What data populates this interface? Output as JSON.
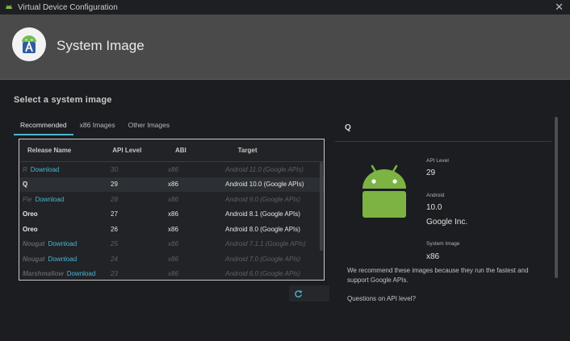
{
  "window": {
    "title": "Virtual Device Configuration",
    "close_glyph": "✕"
  },
  "header": {
    "title": "System Image"
  },
  "section": {
    "title": "Select a system image"
  },
  "tabs": [
    {
      "label": "Recommended",
      "active": true
    },
    {
      "label": "x86 Images",
      "active": false
    },
    {
      "label": "Other Images",
      "active": false
    }
  ],
  "table": {
    "columns": [
      "Release Name",
      "API Level",
      "ABI",
      "Target"
    ],
    "rows": [
      {
        "release": "R",
        "download": "Download",
        "api": "30",
        "abi": "x86",
        "target": "Android 11.0 (Google APIs)",
        "available": false,
        "selected": false
      },
      {
        "release": "Q",
        "download": "",
        "api": "29",
        "abi": "x86",
        "target": "Android 10.0 (Google APIs)",
        "available": true,
        "selected": true
      },
      {
        "release": "Pie",
        "download": "Download",
        "api": "28",
        "abi": "x86",
        "target": "Android 9.0 (Google APIs)",
        "available": false,
        "selected": false
      },
      {
        "release": "Oreo",
        "download": "",
        "api": "27",
        "abi": "x86",
        "target": "Android 8.1 (Google APIs)",
        "available": true,
        "selected": false
      },
      {
        "release": "Oreo",
        "download": "",
        "api": "26",
        "abi": "x86",
        "target": "Android 8.0 (Google APIs)",
        "available": true,
        "selected": false
      },
      {
        "release": "Nougat",
        "download": "Download",
        "api": "25",
        "abi": "x86",
        "target": "Android 7.1.1 (Google APIs)",
        "available": false,
        "selected": false
      },
      {
        "release": "Nougat",
        "download": "Download",
        "api": "24",
        "abi": "x86",
        "target": "Android 7.0 (Google APIs)",
        "available": false,
        "selected": false
      },
      {
        "release": "Marshmallow",
        "download": "Download",
        "api": "23",
        "abi": "x86",
        "target": "Android 6.0 (Google APIs)",
        "available": false,
        "selected": false
      }
    ]
  },
  "details": {
    "title": "Q",
    "api_level_label": "API Level",
    "api_level": "29",
    "android_label": "Android",
    "android_version": "10.0",
    "vendor": "Google Inc.",
    "system_image_label": "System Image",
    "system_image": "x86",
    "description": "We recommend these images because they run the fastest and support Google APIs.",
    "question": "Questions on API level?"
  },
  "icons": {
    "refresh": "refresh-icon",
    "android": "android-robot-icon",
    "studio": "android-studio-icon"
  },
  "colors": {
    "accent": "#4fb4cf",
    "android_green": "#7cb342",
    "header_bg": "#4a4a4a"
  }
}
